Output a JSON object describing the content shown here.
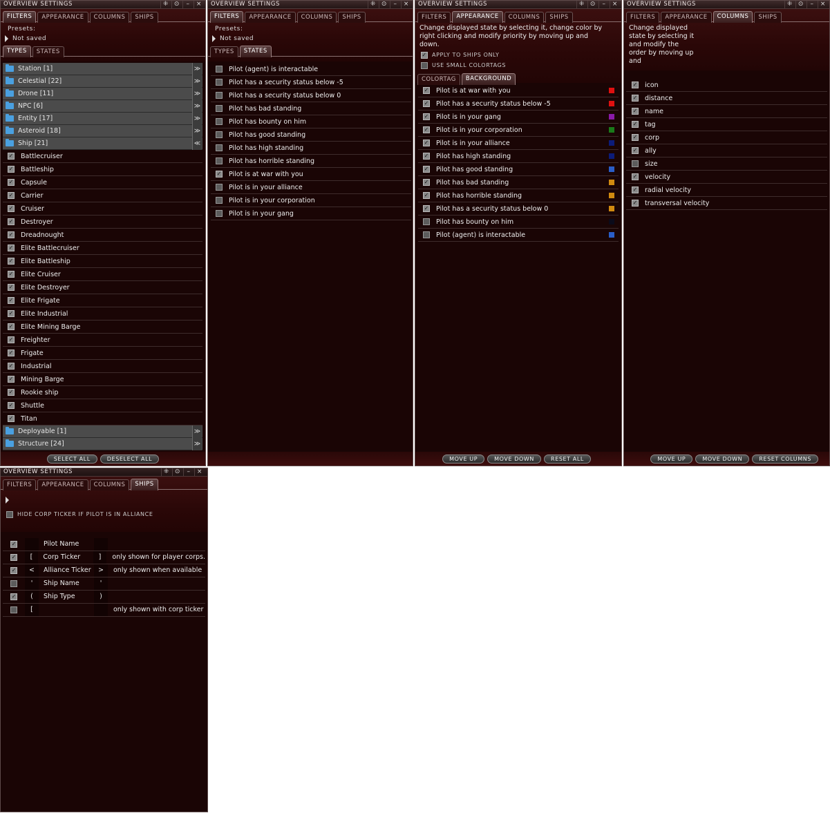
{
  "window_title": "OVERVIEW SETTINGS",
  "title_controls": [
    "⁜",
    "⊙",
    "–",
    "×"
  ],
  "tabs": [
    "FILTERS",
    "APPEARANCE",
    "COLUMNS",
    "SHIPS"
  ],
  "filters": {
    "presets_label": "Presets:",
    "preset_value": "Not saved",
    "subtabs": [
      "TYPES",
      "STATES"
    ],
    "groups_top": [
      {
        "label": "Station [1]",
        "expander": "≫"
      },
      {
        "label": "Celestial [22]",
        "expander": "≫"
      },
      {
        "label": "Drone [11]",
        "expander": "≫"
      },
      {
        "label": "NPC [6]",
        "expander": "≫"
      },
      {
        "label": "Entity [17]",
        "expander": "≫"
      },
      {
        "label": "Asteroid [18]",
        "expander": "≫"
      },
      {
        "label": "Ship [21]",
        "expander": "≪"
      }
    ],
    "ship_types": [
      "Battlecruiser",
      "Battleship",
      "Capsule",
      "Carrier",
      "Cruiser",
      "Destroyer",
      "Dreadnought",
      "Elite Battlecruiser",
      "Elite Battleship",
      "Elite Cruiser",
      "Elite Destroyer",
      "Elite Frigate",
      "Elite Industrial",
      "Elite Mining Barge",
      "Freighter",
      "Frigate",
      "Industrial",
      "Mining Barge",
      "Rookie ship",
      "Shuttle",
      "Titan"
    ],
    "groups_bottom": [
      {
        "label": "Deployable [1]",
        "expander": "≫"
      },
      {
        "label": "Structure [24]",
        "expander": "≫"
      }
    ],
    "select_all": "SELECT ALL",
    "deselect_all": "DESELECT ALL"
  },
  "states": {
    "presets_label": "Presets:",
    "preset_value": "Not saved",
    "subtabs": [
      "TYPES",
      "STATES"
    ],
    "items": [
      {
        "label": "Pilot (agent) is interactable",
        "checked": false
      },
      {
        "label": "Pilot has a security status below -5",
        "checked": false
      },
      {
        "label": "Pilot has a security status below 0",
        "checked": false
      },
      {
        "label": "Pilot has bad standing",
        "checked": false
      },
      {
        "label": "Pilot has bounty on him",
        "checked": false
      },
      {
        "label": "Pilot has good standing",
        "checked": false
      },
      {
        "label": "Pilot has high standing",
        "checked": false
      },
      {
        "label": "Pilot has horrible standing",
        "checked": false
      },
      {
        "label": "Pilot is at war with you",
        "checked": true
      },
      {
        "label": "Pilot is in your alliance",
        "checked": false
      },
      {
        "label": "Pilot is in your corporation",
        "checked": false
      },
      {
        "label": "Pilot is in your gang",
        "checked": false
      }
    ]
  },
  "appearance": {
    "description": "Change displayed state by selecting it, change color by right clicking and modify priority by moving up and down.",
    "apply_ships_only": "APPLY TO SHIPS ONLY",
    "use_small_colortags": "USE SMALL COLORTAGS",
    "subtabs": [
      "COLORTAG",
      "BACKGROUND"
    ],
    "items": [
      {
        "label": "Pilot is at war with you",
        "checked": true,
        "color": "#e01010"
      },
      {
        "label": "Pilot has a security status below -5",
        "checked": true,
        "color": "#e01010"
      },
      {
        "label": "Pilot is in your gang",
        "checked": true,
        "color": "#8a1aa8"
      },
      {
        "label": "Pilot is in your corporation",
        "checked": true,
        "color": "#1a7a1a"
      },
      {
        "label": "Pilot is in your alliance",
        "checked": true,
        "color": "#0c1c7a"
      },
      {
        "label": "Pilot has high standing",
        "checked": true,
        "color": "#0c1c7a"
      },
      {
        "label": "Pilot has good standing",
        "checked": true,
        "color": "#2a5ec8"
      },
      {
        "label": "Pilot has bad standing",
        "checked": true,
        "color": "#d08a10"
      },
      {
        "label": "Pilot has horrible standing",
        "checked": true,
        "color": "#d08a10"
      },
      {
        "label": "Pilot has a security status below 0",
        "checked": true,
        "color": "#d08a10"
      },
      {
        "label": "Pilot has bounty on him",
        "checked": false,
        "color": "#0b0b1a"
      },
      {
        "label": "Pilot (agent) is interactable",
        "checked": false,
        "color": "#2a5ec8"
      }
    ],
    "move_up": "MOVE UP",
    "move_down": "MOVE DOWN",
    "reset_all": "RESET ALL"
  },
  "columns": {
    "description": "Change displayed state by selecting it and modify the order by moving up and",
    "items": [
      {
        "label": "icon",
        "checked": true
      },
      {
        "label": "distance",
        "checked": true
      },
      {
        "label": "name",
        "checked": true
      },
      {
        "label": "tag",
        "checked": true
      },
      {
        "label": "corp",
        "checked": true
      },
      {
        "label": "ally",
        "checked": true
      },
      {
        "label": "size",
        "checked": false
      },
      {
        "label": "velocity",
        "checked": true
      },
      {
        "label": "radial velocity",
        "checked": true
      },
      {
        "label": "transversal velocity",
        "checked": true
      }
    ],
    "move_up": "MOVE UP",
    "move_down": "MOVE DOWN",
    "reset_columns": "RESET COLUMNS"
  },
  "ships": {
    "hide_corp_ticker": "HIDE CORP TICKER IF PILOT IS IN ALLIANCE",
    "rows": [
      {
        "checked": true,
        "pre": "",
        "name": "Pilot Name",
        "post": "",
        "note": ""
      },
      {
        "checked": true,
        "pre": "[",
        "name": "Corp Ticker",
        "post": "]",
        "note": "only shown for player corps."
      },
      {
        "checked": true,
        "pre": "<",
        "name": "Alliance Ticker",
        "post": ">",
        "note": "only shown when available"
      },
      {
        "checked": false,
        "pre": "'",
        "name": "Ship Name",
        "post": "'",
        "note": ""
      },
      {
        "checked": true,
        "pre": "(",
        "name": "Ship Type",
        "post": ")",
        "note": ""
      },
      {
        "checked": false,
        "pre": "[",
        "name": "",
        "post": "",
        "note": "only shown with corp ticker"
      }
    ]
  },
  "check_mark": "✓"
}
